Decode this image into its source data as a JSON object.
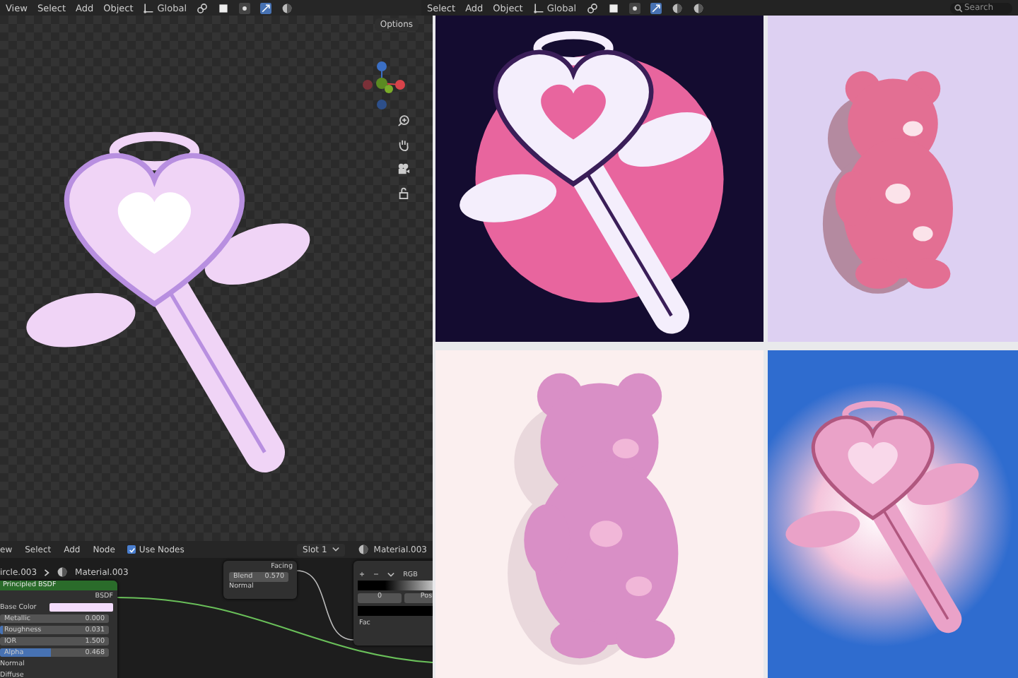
{
  "viewport_header": {
    "menus": [
      "View",
      "Select",
      "Add",
      "Object"
    ],
    "orientation": "Global",
    "options": "Options"
  },
  "second_header": {
    "menus": [
      "Select",
      "Add",
      "Object"
    ],
    "orientation": "Global",
    "search": {
      "placeholder": "Search"
    }
  },
  "node_editor": {
    "menus": [
      "ew",
      "Select",
      "Add",
      "Node"
    ],
    "use_nodes": {
      "label": "Use Nodes",
      "checked": true
    },
    "slot": "Slot 1",
    "material": "Material.003",
    "breadcrumb": [
      "ircle.003",
      "Material.003"
    ],
    "bsdf_node": {
      "title": "Principled BSDF",
      "output": "BSDF",
      "base_color": {
        "label": "Base Color",
        "color": "#f3dcfb"
      },
      "fields": [
        {
          "label": "Metallic",
          "value": "0.000"
        },
        {
          "label": "Roughness",
          "value": "0.031",
          "level": 0.031
        },
        {
          "label": "IOR",
          "value": "1.500"
        },
        {
          "label": "Alpha",
          "value": "0.468",
          "level": 0.468
        }
      ],
      "sockets": [
        "Normal",
        "Diffuse"
      ]
    },
    "layer_weight_node": {
      "output": "Facing",
      "blend": {
        "label": "Blend",
        "value": "0.570"
      },
      "input": "Normal"
    },
    "color_ramp_node": {
      "controls": [
        "+",
        "−"
      ],
      "mode": "RGB",
      "index": "0",
      "pos_label": "Pos",
      "input": "Fac"
    }
  }
}
